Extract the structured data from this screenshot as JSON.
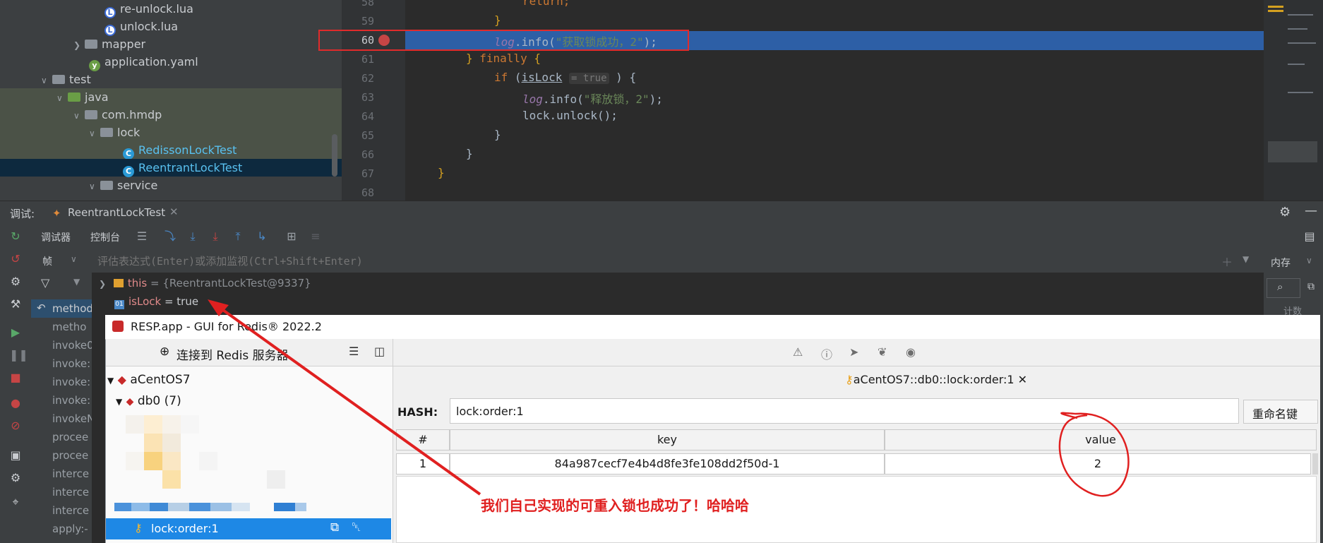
{
  "tree": {
    "items": [
      {
        "label": "re-unlock.lua"
      },
      {
        "label": "unlock.lua"
      },
      {
        "label": "mapper"
      },
      {
        "label": "application.yaml"
      },
      {
        "label": "test"
      },
      {
        "label": "java"
      },
      {
        "label": "com.hmdp"
      },
      {
        "label": "lock"
      },
      {
        "label": "RedissonLockTest"
      },
      {
        "label": "ReentrantLockTest"
      },
      {
        "label": "service"
      }
    ]
  },
  "editor": {
    "line_numbers": [
      "58",
      "59",
      "60",
      "61",
      "62",
      "63",
      "64",
      "65",
      "66",
      "67",
      "68"
    ],
    "current_line": "60",
    "code": {
      "l58": "return;",
      "l59": "}",
      "l60_obj": "log",
      "l60_call": ".info(",
      "l60_str": "\"获取锁成功，2\"",
      "l60_end": ");",
      "l61_a": "} ",
      "l61_kw": "finally",
      "l61_b": " {",
      "l62_kw": "if",
      "l62_a": " (",
      "l62_var": "isLock",
      "l62_hint": "= true",
      "l62_b": " ) {",
      "l63_obj": "log",
      "l63_call": ".info(",
      "l63_str": "\"释放锁，2\"",
      "l63_end": ");",
      "l64": "lock.unlock();",
      "l65": "}",
      "l66": "}",
      "l67": "}"
    }
  },
  "debug": {
    "label": "调试:",
    "session_tab": "ReentrantLockTest",
    "tab_debugger": "调试器",
    "tab_console": "控制台",
    "frames_label": "帧",
    "eval_placeholder": "评估表达式(Enter)或添加监视(Ctrl+Shift+Enter)",
    "memory_label": "内存",
    "count_label": "计数",
    "vars": [
      {
        "name": "this",
        "value": "= {ReentrantLockTest@9337}"
      },
      {
        "name": "isLock",
        "value": "= true"
      }
    ],
    "frames": [
      "method",
      "metho",
      "invoke0",
      "invoke:",
      "invoke:",
      "invoke:",
      "invokeN",
      "procee",
      "procee",
      "interce",
      "interce",
      "interce",
      "apply:-"
    ]
  },
  "resp": {
    "title": "RESP.app - GUI for Redis® 2022.2",
    "connect_label": "连接到 Redis 服务器",
    "connection": "aCentOS7",
    "db": "db0",
    "db_count": "(7)",
    "selected_key": "lock:order:1",
    "tab_title": "aCentOS7::db0::lock:order:1",
    "type_label": "HASH:",
    "key_name": "lock:order:1",
    "rename_button": "重命名键",
    "table": {
      "headers": [
        "#",
        "key",
        "value"
      ],
      "rows": [
        {
          "index": "1",
          "key": "84a987cecf7e4b4d8fe3fe108dd2f50d-1",
          "value": "2"
        }
      ]
    }
  },
  "annotation": "我们自己实现的可重入锁也成功了！哈哈哈",
  "colors": {
    "highlight": "#2d5fa6",
    "annotation_red": "#e02020",
    "breakpoint": "#c64545",
    "resp_selected": "#1e88e5"
  }
}
